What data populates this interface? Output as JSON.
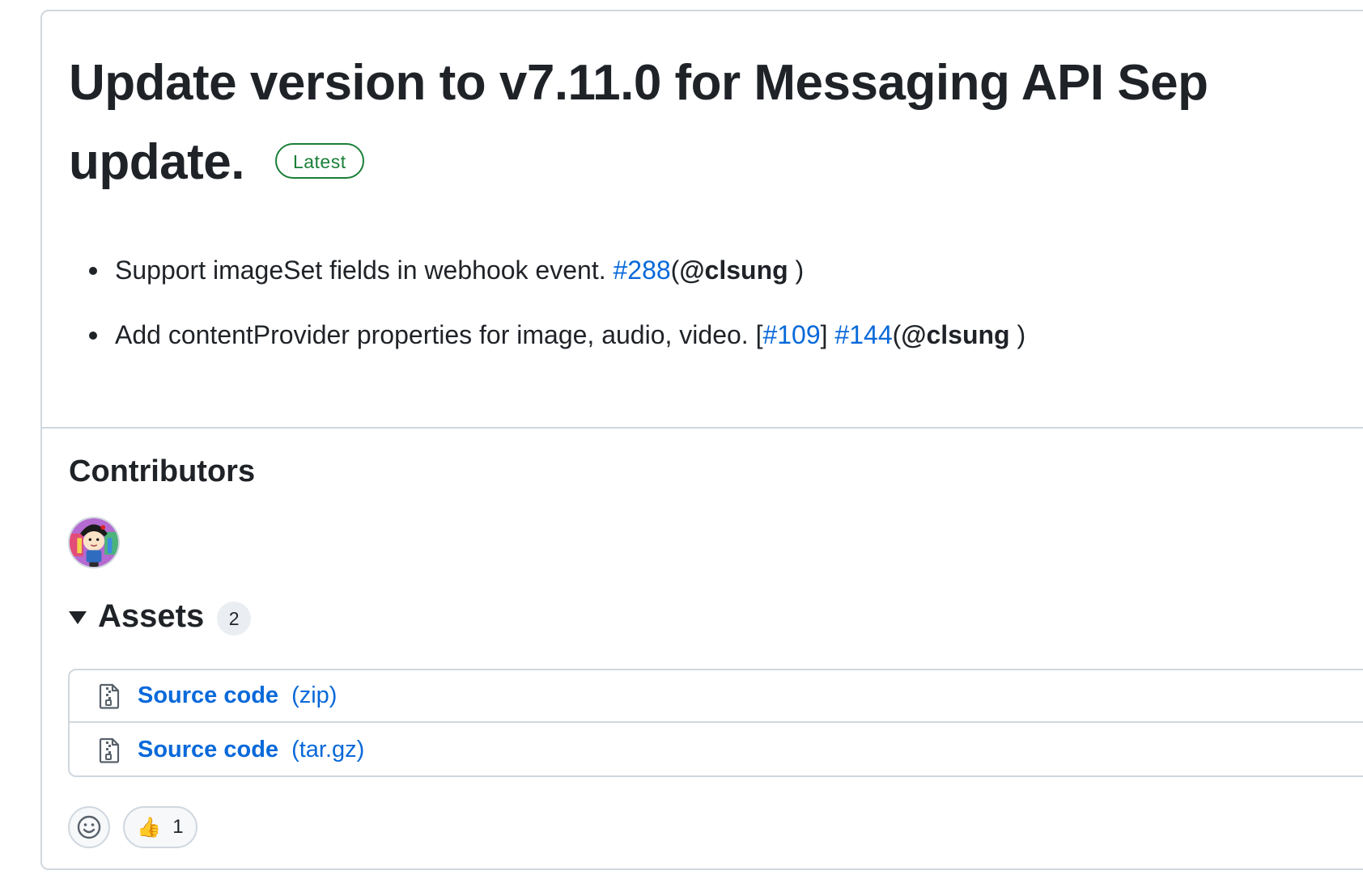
{
  "release": {
    "title": "Update version to v7.11.0 for Messaging API Sep update.",
    "badge": "Latest"
  },
  "notes": [
    {
      "text": "Support imageSet fields in webhook event. ",
      "link": "#288",
      "open_paren": "(",
      "mention": "@clsung",
      "close_paren": " )"
    },
    {
      "text": "Add contentProvider properties for image, audio, video. [",
      "link1": "#109",
      "between": "] ",
      "link2": "#144",
      "open_paren": "(",
      "mention": "@clsung",
      "close_paren": " )"
    }
  ],
  "contributors": {
    "heading": "Contributors",
    "avatars": [
      {
        "icon": "avatar-cartoon-character"
      }
    ]
  },
  "assets": {
    "label": "Assets",
    "count": "2",
    "items": [
      {
        "name": "Source code",
        "ext": "(zip)",
        "icon": "file-zip-icon"
      },
      {
        "name": "Source code",
        "ext": "(tar.gz)",
        "icon": "file-zip-icon"
      }
    ]
  },
  "reactions": {
    "add_icon": "smiley-icon",
    "items": [
      {
        "emoji": "👍",
        "count": "1"
      }
    ]
  },
  "colors": {
    "link": "#0969da",
    "latest_badge": "#1a7f37",
    "border": "#d0d7de",
    "text": "#1f2328"
  }
}
